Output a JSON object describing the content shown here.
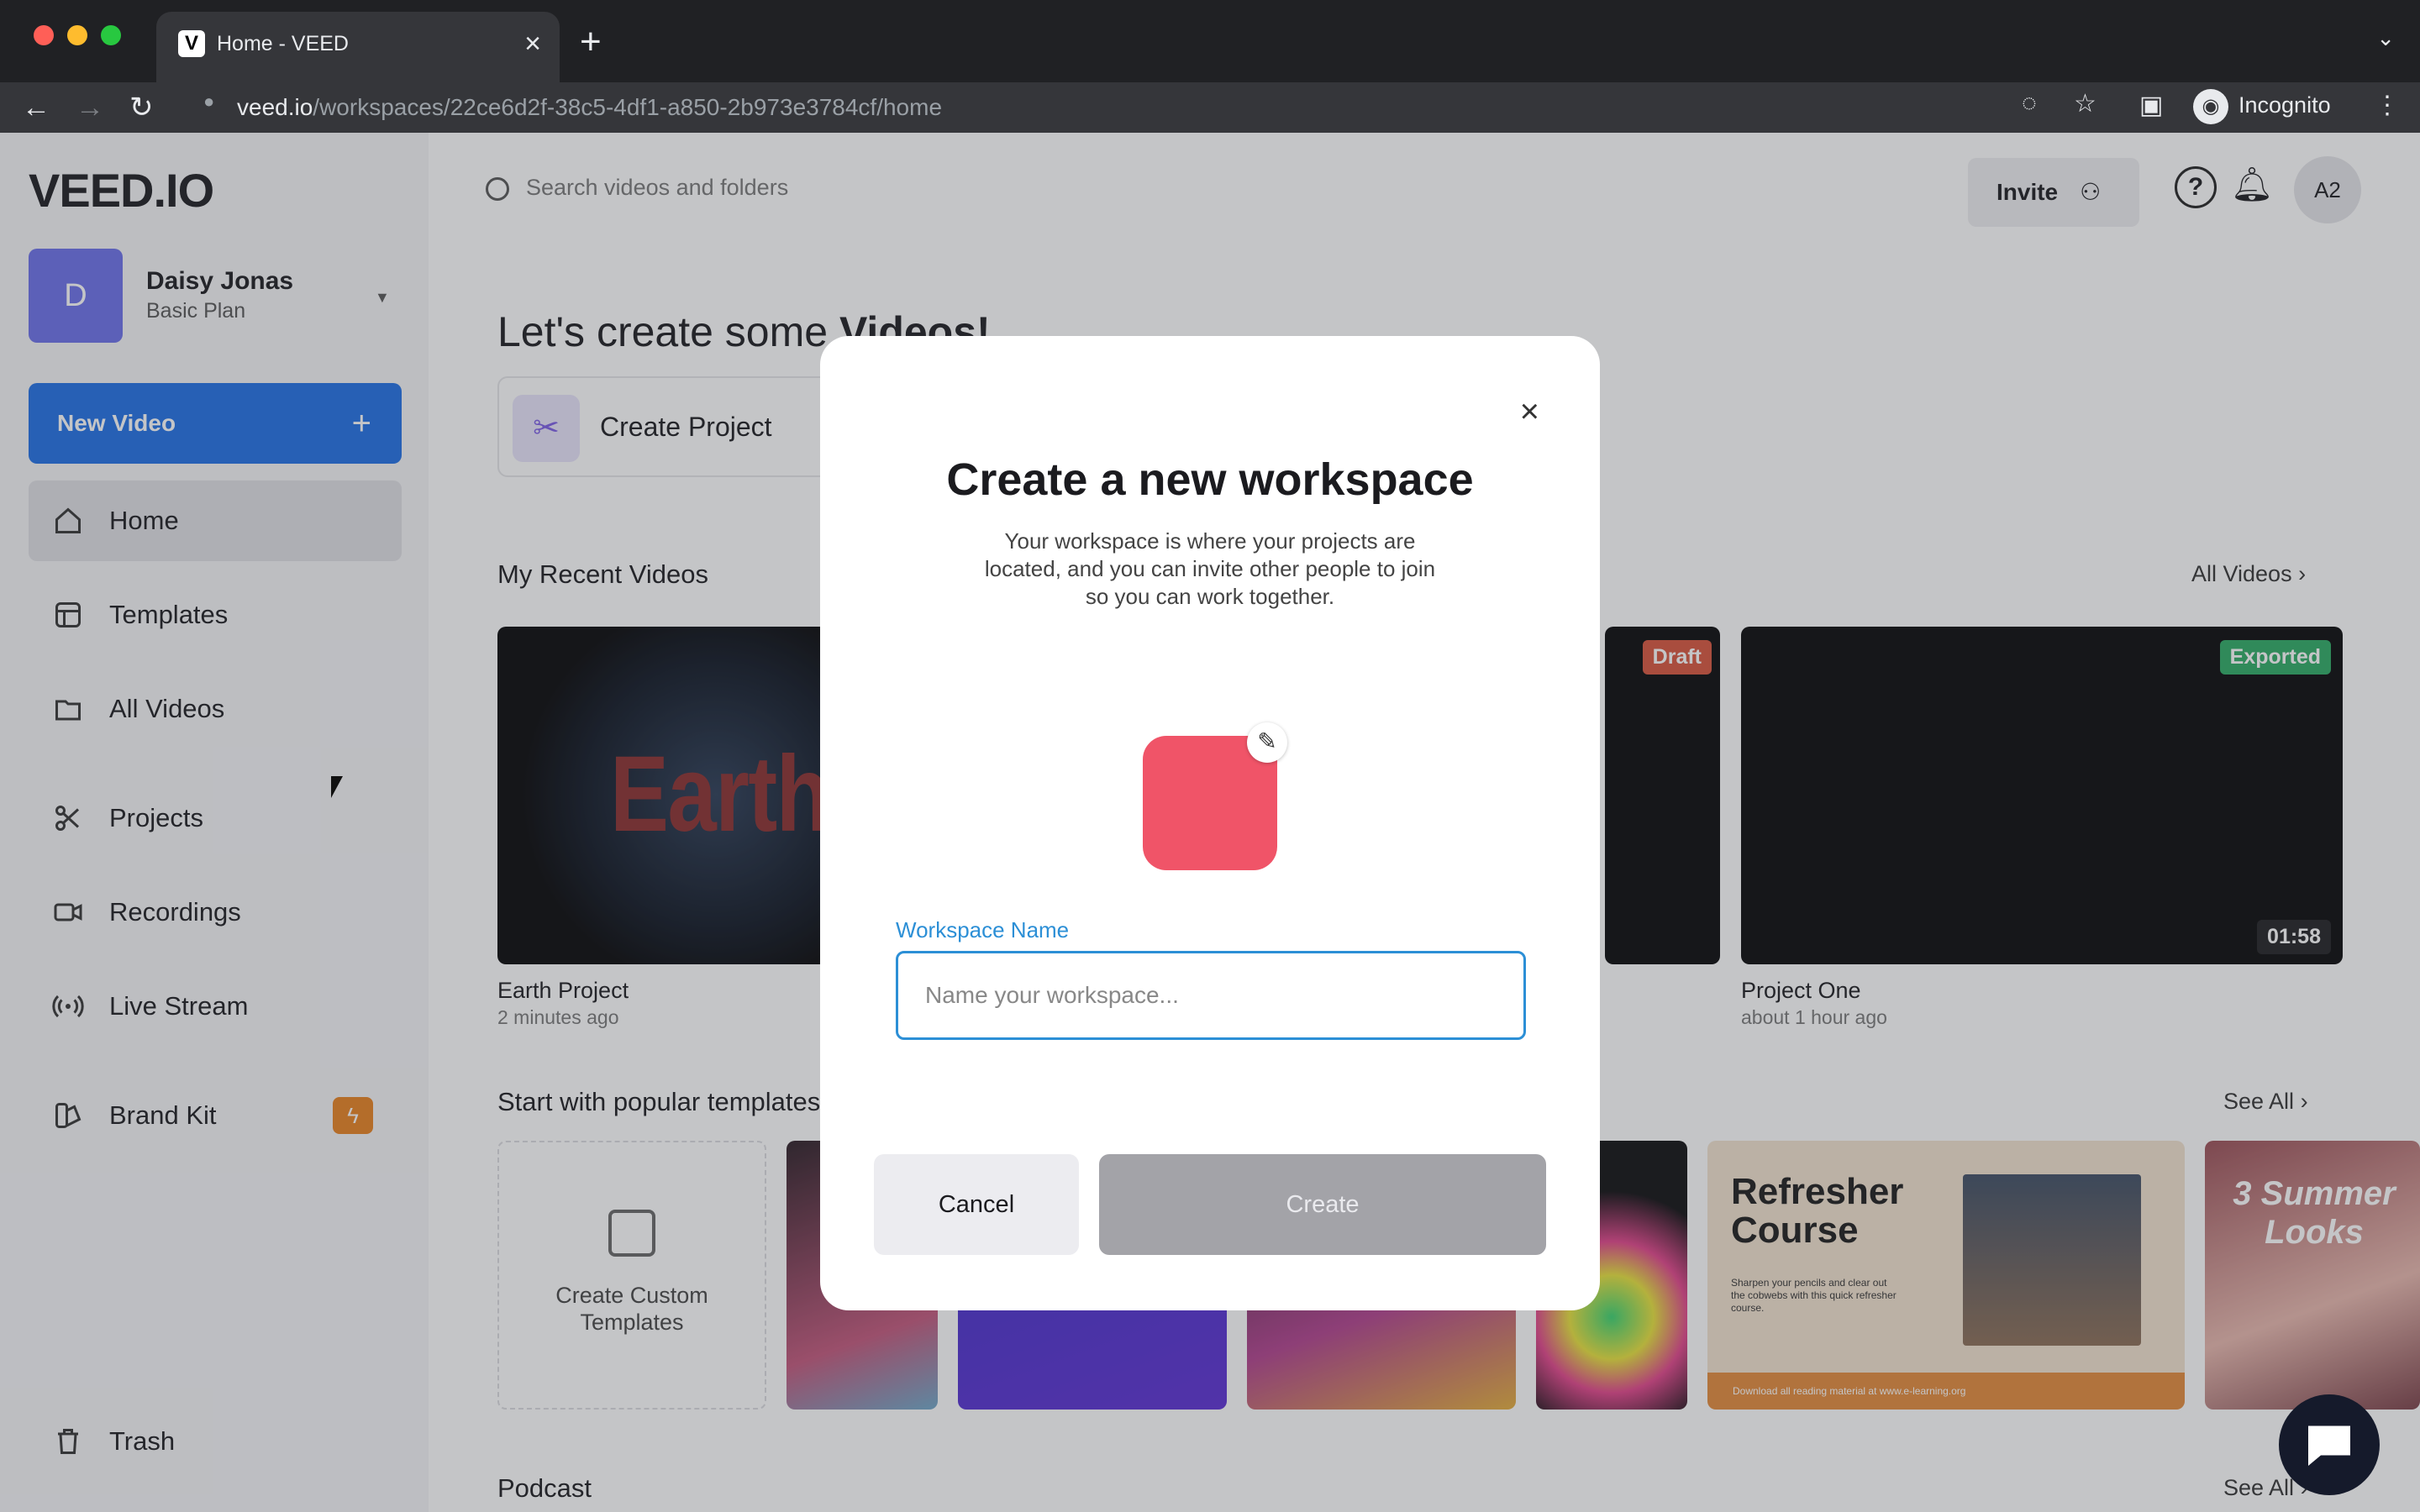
{
  "browser": {
    "tab_title": "Home - VEED",
    "tab_favicon": "V",
    "url_host": "veed.io",
    "url_path": "/workspaces/22ce6d2f-38c5-4df1-a850-2b973e3784cf/home",
    "profile_label": "Incognito"
  },
  "sidebar": {
    "logo": "VEED.IO",
    "user": {
      "initial": "D",
      "name": "Daisy Jonas",
      "plan": "Basic Plan"
    },
    "new_video_label": "New Video",
    "items": [
      {
        "label": "Home",
        "icon": "home-icon"
      },
      {
        "label": "Templates",
        "icon": "templates-icon"
      },
      {
        "label": "All Videos",
        "icon": "folder-icon"
      },
      {
        "label": "Projects",
        "icon": "scissors-icon"
      },
      {
        "label": "Recordings",
        "icon": "camera-icon"
      },
      {
        "label": "Live Stream",
        "icon": "broadcast-icon"
      },
      {
        "label": "Brand Kit",
        "icon": "brand-kit-icon"
      },
      {
        "label": "Trash",
        "icon": "trash-icon"
      }
    ]
  },
  "header": {
    "search_placeholder": "Search videos and folders",
    "invite_label": "Invite",
    "account_initials": "A2"
  },
  "main": {
    "heading_prefix": "Let's create some",
    "heading_bold": "Videos!",
    "create_project_label": "Create Project",
    "recent_title": "My Recent Videos",
    "all_videos_link": "All Videos",
    "videos": [
      {
        "title": "Earth Project",
        "time": "2 minutes ago",
        "thumb_text": "Earth"
      },
      {
        "title": "Project One",
        "time": "about 1 hour ago",
        "status": "Exported",
        "duration": "01:58"
      }
    ],
    "draft_badge": "Draft",
    "templates_title": "Start with popular templates",
    "see_all": "See All",
    "create_custom_label": "Create Custom Templates",
    "template_refresher_title": "Refresher Course",
    "template_refresher_body": "Sharpen your pencils and clear out the cobwebs with this quick refresher course.",
    "template_refresher_footer": "Download all reading material at www.e-learning.org",
    "template_summer_text": "3 Summer Looks",
    "podcast_title": "Podcast"
  },
  "modal": {
    "title": "Create a new workspace",
    "description": "Your workspace is where your projects are located, and you can invite other people to join so you can work together.",
    "field_label": "Workspace Name",
    "field_placeholder": "Name your workspace...",
    "field_value": "",
    "cancel_label": "Cancel",
    "create_label": "Create",
    "icon_color": "#f05468"
  },
  "colors": {
    "accent": "#1f6fe5",
    "badge_draft": "#d9533b",
    "badge_exported": "#2bab64",
    "brand_badge": "#e9811f"
  }
}
